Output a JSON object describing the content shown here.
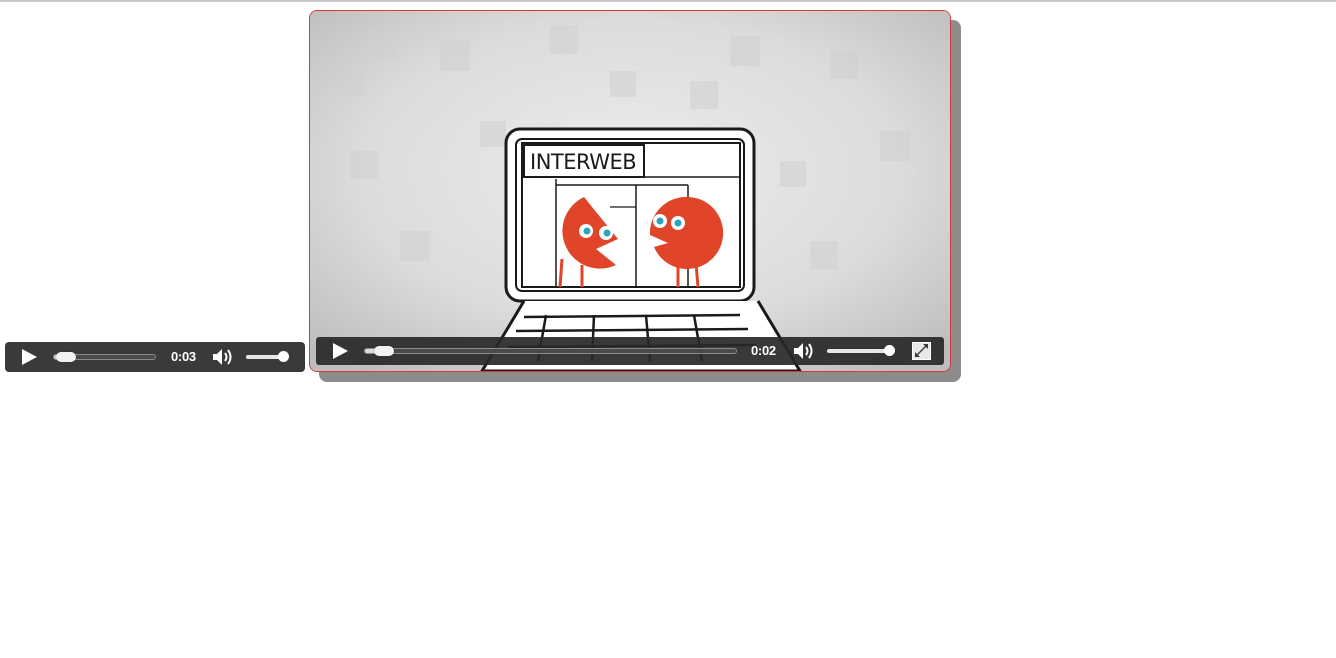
{
  "audio_player": {
    "time": "0:03",
    "progress_fraction": 0.12,
    "volume_fraction": 1.0,
    "icons": [
      "play-icon",
      "volume-icon"
    ]
  },
  "video_player": {
    "time": "0:02",
    "progress_fraction": 0.05,
    "volume_fraction": 1.0,
    "icons": [
      "play-icon",
      "volume-icon",
      "fullscreen-icon"
    ],
    "frame": {
      "laptop_screen_label": "INTERWEB"
    }
  },
  "colors": {
    "control_bar": "#3a3a3a",
    "video_border": "#d43a3a",
    "character_red": "#e0452a",
    "eye_blue": "#2aa4b8"
  }
}
